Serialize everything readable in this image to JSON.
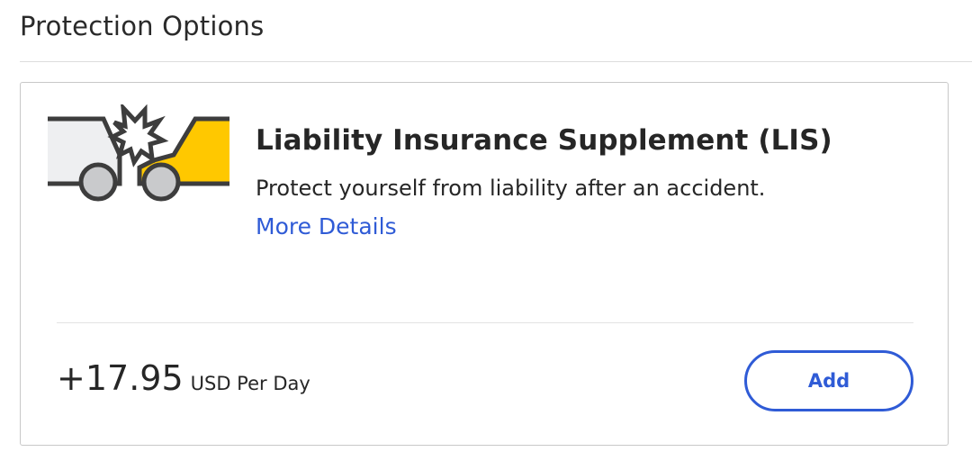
{
  "section": {
    "title": "Protection Options"
  },
  "card": {
    "illustration_icon": "car-collision-icon",
    "title": "Liability Insurance Supplement (LIS)",
    "description": "Protect yourself from liability after an accident.",
    "more_details_label": "More Details",
    "price": {
      "amount": "+17.95",
      "unit": "USD Per Day"
    },
    "add_label": "Add"
  },
  "colors": {
    "accent": "#2f5bd6",
    "car_yellow": "#ffc800",
    "car_gray": "#eeeff1",
    "outline": "#3d3d3d",
    "wheel": "#c9cacc"
  }
}
